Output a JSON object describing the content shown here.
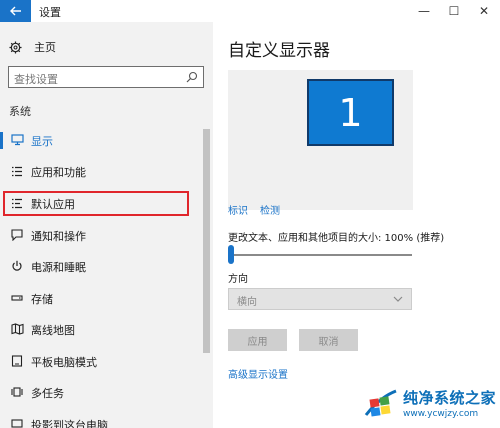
{
  "window": {
    "title": "设置",
    "minimize": "—",
    "maximize": "☐",
    "close": "✕"
  },
  "sidebar": {
    "home_label": "主页",
    "search_placeholder": "查找设置",
    "section_label": "系统",
    "items": [
      {
        "label": "显示",
        "icon": "monitor-icon",
        "active": true
      },
      {
        "label": "应用和功能",
        "icon": "list-icon"
      },
      {
        "label": "默认应用",
        "icon": "default-apps-icon",
        "highlighted": true
      },
      {
        "label": "通知和操作",
        "icon": "message-icon"
      },
      {
        "label": "电源和睡眠",
        "icon": "power-icon"
      },
      {
        "label": "存储",
        "icon": "storage-icon"
      },
      {
        "label": "离线地图",
        "icon": "map-icon"
      },
      {
        "label": "平板电脑模式",
        "icon": "tablet-icon"
      },
      {
        "label": "多任务",
        "icon": "multitask-icon"
      },
      {
        "label": "投影到这台电脑",
        "icon": "project-icon"
      }
    ]
  },
  "main": {
    "title": "自定义显示器",
    "monitor_number": "1",
    "identify_link": "标识",
    "detect_link": "检测",
    "scale_label": "更改文本、应用和其他项目的大小: 100% (推荐)",
    "scale_level_fraction": 0,
    "orientation_label": "方向",
    "orientation_value": "横向",
    "apply_button": "应用",
    "cancel_button": "取消",
    "advanced_link": "高级显示设置"
  },
  "watermark": {
    "title": "纯净系统之家",
    "url": "www.ycwjzy.com"
  },
  "colors": {
    "accent": "#1a73c8",
    "highlight_border": "#e0262c",
    "monitor_fill": "#0f7ad1"
  }
}
